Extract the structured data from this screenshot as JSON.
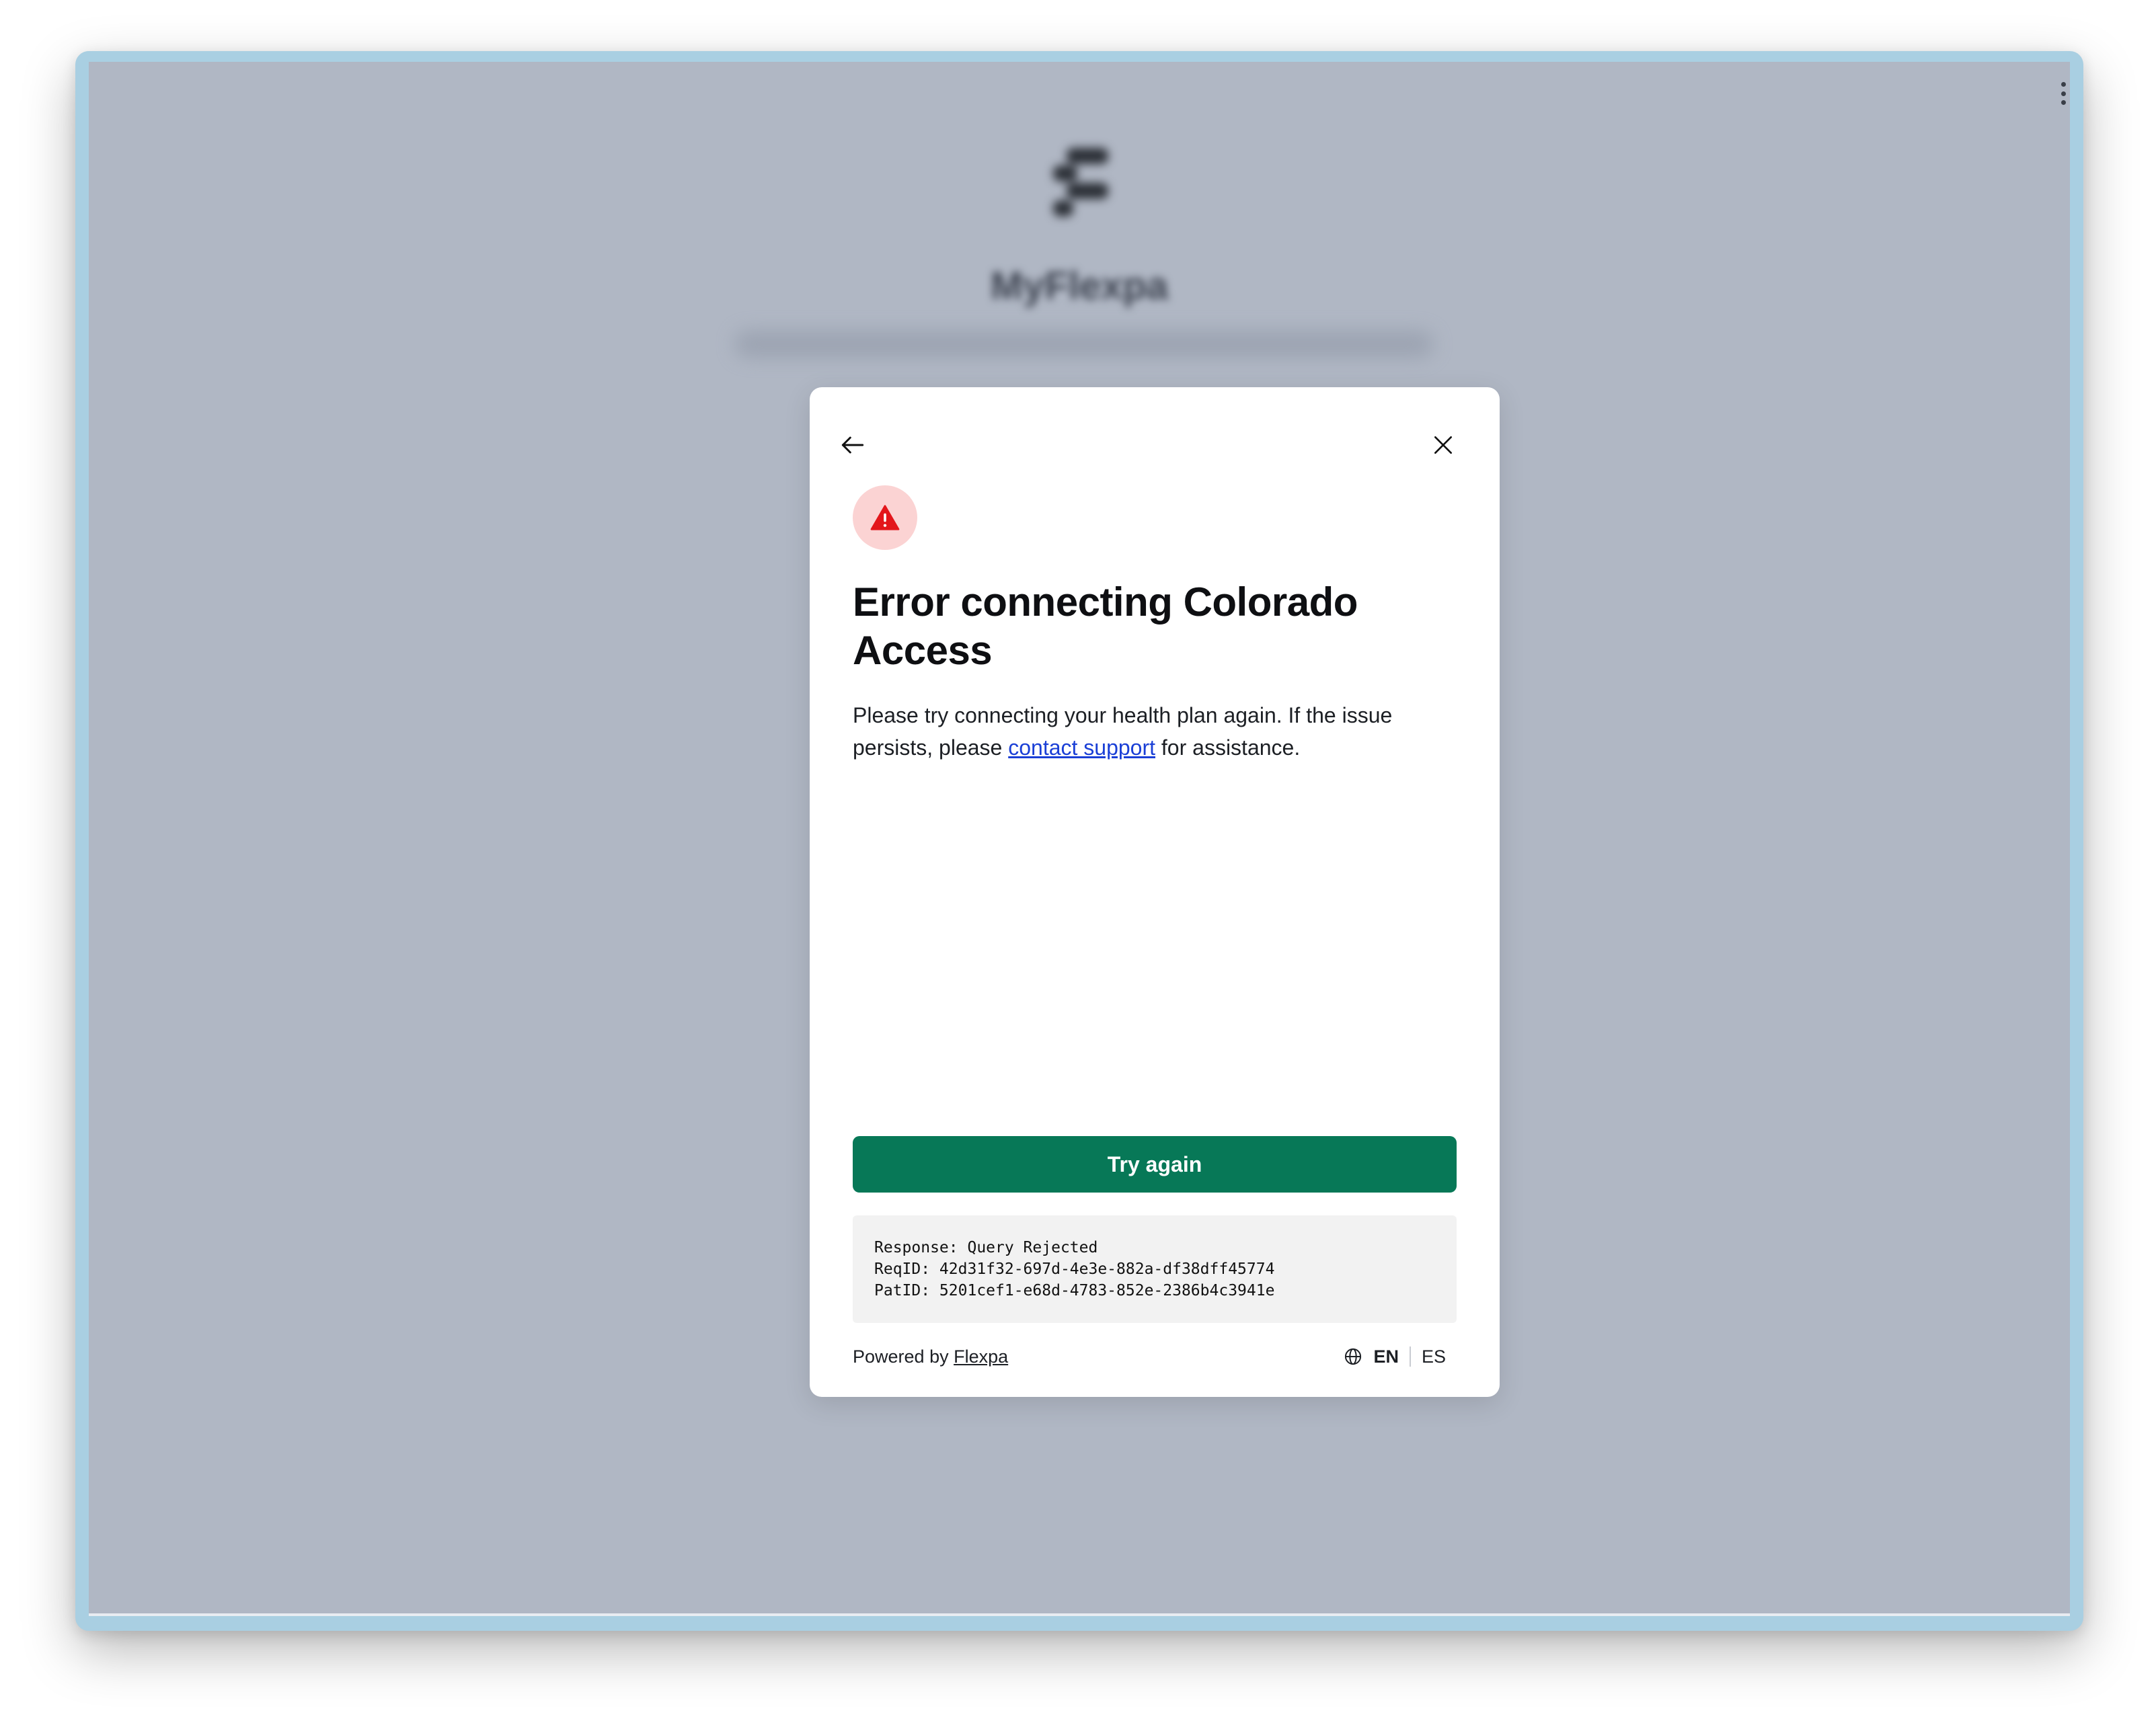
{
  "background": {
    "app_name": "MyFlexpa"
  },
  "modal": {
    "title": "Error connecting Colorado Access",
    "message_before": "Please try connecting your health plan again. If the issue persists, please ",
    "support_link": "contact support",
    "message_after": " for assistance.",
    "try_again_label": "Try again",
    "debug": {
      "response": "Response: Query Rejected",
      "req_id": "ReqID: 42d31f32-697d-4e3e-882a-df38dff45774",
      "pat_id": "PatID: 5201cef1-e68d-4783-852e-2386b4c3941e"
    },
    "footer": {
      "powered_by": "Powered by ",
      "brand_link": "Flexpa",
      "lang_en": "EN",
      "lang_es": "ES"
    }
  },
  "icons": {
    "back": "arrow-left-icon",
    "close": "close-icon",
    "alert": "warning-triangle-icon",
    "globe": "globe-icon"
  },
  "colors": {
    "primary": "#077857",
    "alert_bg": "#fbd3d3",
    "alert_fg": "#e3161b",
    "link": "#1a3fd6",
    "backdrop": "#b0b7c4"
  }
}
